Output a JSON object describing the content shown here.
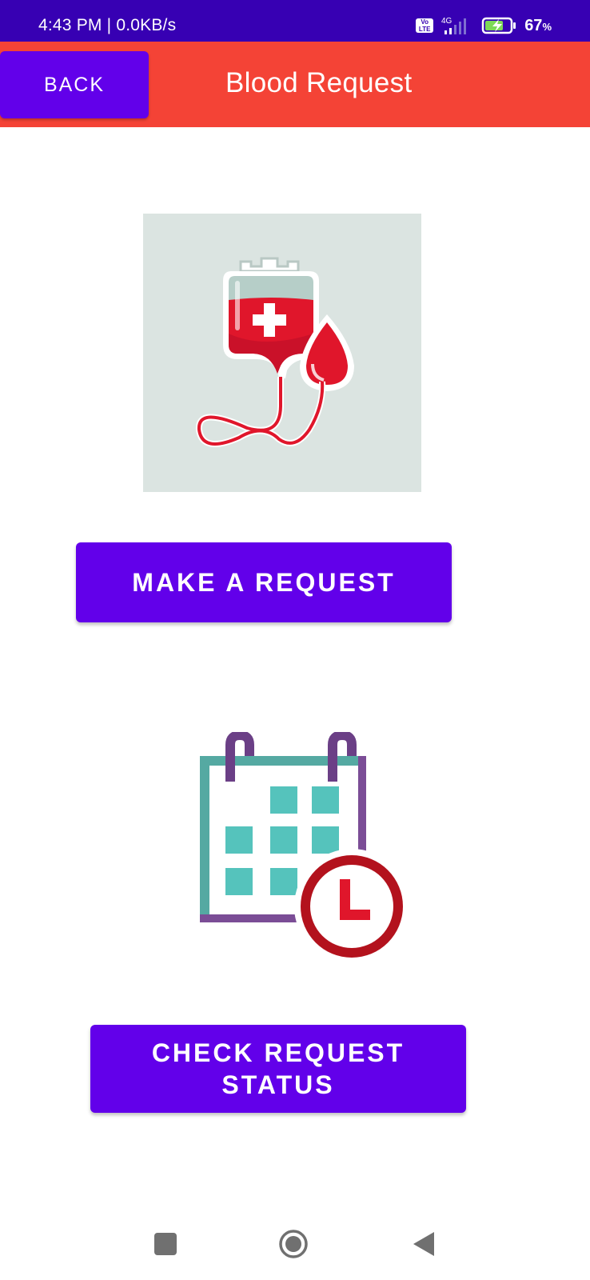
{
  "status_bar": {
    "time": "4:43 PM | 0.0KB/s",
    "volte": "Vo\nLTE",
    "network": "4G",
    "battery_percent": "67",
    "battery_unit": "%"
  },
  "app_bar": {
    "back_label": "BACK",
    "title": "Blood Request"
  },
  "main": {
    "make_request_label": "MAKE A REQUEST",
    "check_status_label_line1": "CHECK REQUEST",
    "check_status_label_line2": "STATUS"
  },
  "colors": {
    "status_bar": "#3700b3",
    "app_bar": "#f44336",
    "button": "#6200ea",
    "blood_red": "#e0162b",
    "calendar_teal": "#55c3bc",
    "calendar_purple": "#7b4d96"
  },
  "icons": {
    "blood_bag": "blood-bag-icon",
    "calendar_clock": "calendar-clock-icon",
    "nav_recent": "square-icon",
    "nav_home": "circle-icon",
    "nav_back": "triangle-back-icon"
  }
}
